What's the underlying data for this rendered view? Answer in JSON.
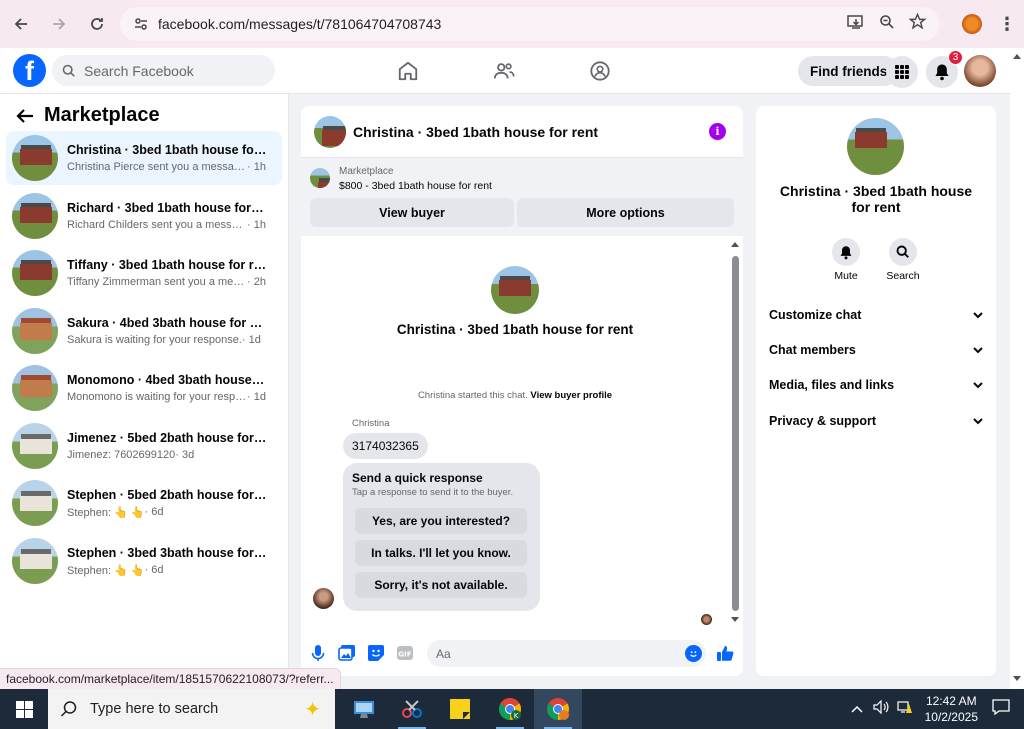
{
  "browser": {
    "url": "facebook.com/messages/t/781064704708743",
    "status_url": "facebook.com/marketplace/item/1851570622108073/?referr..."
  },
  "header": {
    "search_placeholder": "Search Facebook",
    "find_friends_label": "Find friends",
    "notification_count": "3"
  },
  "left": {
    "title": "Marketplace",
    "conversations": [
      {
        "name": "Christina · 3bed 1bath house for rent",
        "message": "Christina Pierce sent you a message a...",
        "time": "· 1h",
        "thumb": "house-red"
      },
      {
        "name": "Richard · 3bed 1bath house for rent",
        "message": "Richard Childers sent you a message ...",
        "time": "· 1h",
        "thumb": "house-red"
      },
      {
        "name": "Tiffany · 3bed 1bath house for rent",
        "message": "Tiffany Zimmerman sent you a messa...",
        "time": "· 2h",
        "thumb": "house-red"
      },
      {
        "name": "Sakura · 4bed 3bath house for rent",
        "message": "Sakura is waiting for your response.",
        "time": "· 1d",
        "thumb": "house-sak"
      },
      {
        "name": "Monomono · 4bed 3bath house fo...",
        "message": "Monomono is waiting for your respo...",
        "time": "· 1d",
        "thumb": "house-sak"
      },
      {
        "name": "Jimenez · 5bed 2bath house for rent",
        "message": "Jimenez: 7602699120",
        "time": "· 3d",
        "thumb": "house-white"
      },
      {
        "name": "Stephen · 5bed 2bath house for rent",
        "message": "Stephen: 👆 👆",
        "time": "· 6d",
        "thumb": "house-white"
      },
      {
        "name": "Stephen · 3bed 3bath house for rent",
        "message": "Stephen: 👆 👆",
        "time": "· 6d",
        "thumb": "house-white"
      }
    ]
  },
  "chat": {
    "title": "Christina · 3bed 1bath house for rent",
    "listing_label": "Marketplace",
    "listing_price": "$800 - 3bed 1bath house for rent",
    "view_buyer": "View buyer",
    "more_options": "More options",
    "started_text": "Christina started this chat.",
    "view_buyer_profile": "View buyer profile",
    "sender_name": "Christina",
    "message": "3174032365",
    "quick_title": "Send a quick response",
    "quick_sub": "Tap a response to send it to the buyer.",
    "quick_replies": [
      "Yes, are you interested?",
      "In talks. I'll let you know.",
      "Sorry, it's not available."
    ],
    "composer_placeholder": "Aa"
  },
  "right": {
    "title": "Christina · 3bed 1bath house for rent",
    "mute": "Mute",
    "search": "Search",
    "sections": [
      "Customize chat",
      "Chat members",
      "Media, files and links",
      "Privacy & support"
    ]
  },
  "taskbar": {
    "search_placeholder": "Type here to search",
    "time": "12:42 AM",
    "date": "10/2/2025"
  }
}
